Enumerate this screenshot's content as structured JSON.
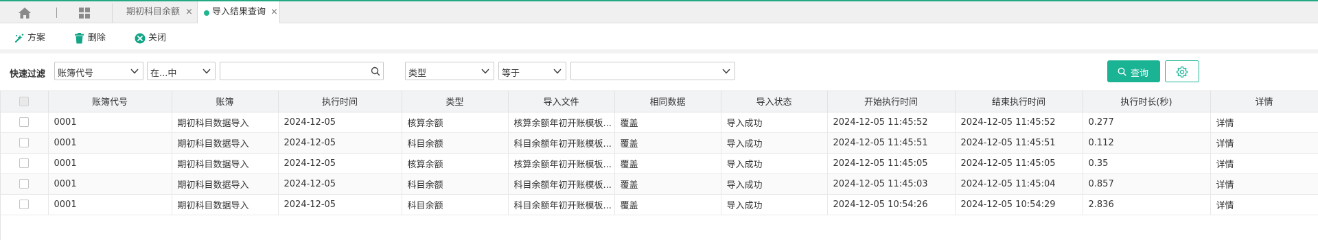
{
  "tabs": [
    {
      "label": "期初科目余额",
      "close": "×"
    },
    {
      "label": "导入结果查询",
      "close": "×"
    }
  ],
  "toolbar": {
    "scheme_label": "方案",
    "delete_label": "删除",
    "close_label": "关闭"
  },
  "filter": {
    "label": "快速过滤",
    "field1": "账簿代号",
    "op1": "在...中",
    "value1": "",
    "field2": "类型",
    "op2": "等于",
    "value2": "",
    "query_label": "查询"
  },
  "table": {
    "headers": [
      "账簿代号",
      "账簿",
      "执行时间",
      "类型",
      "导入文件",
      "相同数据",
      "导入状态",
      "开始执行时间",
      "结束执行时间",
      "执行时长(秒)",
      "详情"
    ],
    "rows": [
      [
        "0001",
        "期初科目数据导入",
        "2024-12-05",
        "核算余额",
        "核算余额年初开账模板...",
        "覆盖",
        "导入成功",
        "2024-12-05 11:45:52",
        "2024-12-05 11:45:52",
        "0.277",
        "详情"
      ],
      [
        "0001",
        "期初科目数据导入",
        "2024-12-05",
        "科目余额",
        "科目余额年初开账模板...",
        "覆盖",
        "导入成功",
        "2024-12-05 11:45:51",
        "2024-12-05 11:45:51",
        "0.112",
        "详情"
      ],
      [
        "0001",
        "期初科目数据导入",
        "2024-12-05",
        "核算余额",
        "核算余额年初开账模板...",
        "覆盖",
        "导入成功",
        "2024-12-05 11:45:05",
        "2024-12-05 11:45:05",
        "0.35",
        "详情"
      ],
      [
        "0001",
        "期初科目数据导入",
        "2024-12-05",
        "科目余额",
        "科目余额年初开账模板...",
        "覆盖",
        "导入成功",
        "2024-12-05 11:45:03",
        "2024-12-05 11:45:04",
        "0.857",
        "详情"
      ],
      [
        "0001",
        "期初科目数据导入",
        "2024-12-05",
        "科目余额",
        "科目余额年初开账模板...",
        "覆盖",
        "导入成功",
        "2024-12-05 10:54:26",
        "2024-12-05 10:54:29",
        "2.836",
        "详情"
      ]
    ]
  },
  "colors": {
    "accent": "#1ab394",
    "tab_dot": "#1fb58f",
    "header_bg": "#f2f3f5"
  },
  "icons": [
    "home-icon",
    "grid-icon",
    "scheme-icon",
    "trash-icon",
    "close-circle-icon",
    "search-icon",
    "caret-down-icon",
    "gear-icon"
  ]
}
